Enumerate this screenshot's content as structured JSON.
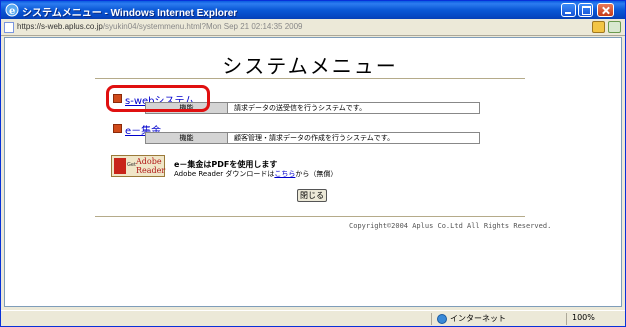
{
  "window": {
    "title": "システムメニュー - Windows Internet Explorer"
  },
  "address": {
    "url_prefix": "https://",
    "url_host": "s-web.aplus.co.jp",
    "url_path": "/syukin04/systemmenu.html?Mon Sep 21 02:14:35 2009"
  },
  "page": {
    "title": "システムメニュー",
    "systems": [
      {
        "link": "s-webシステム",
        "label": "機能",
        "description": "請求データの送受信を行うシステムです。"
      },
      {
        "link": "e－集金",
        "label": "機能",
        "description": "顧客管理・請求データの作成を行うシステムです。"
      }
    ],
    "adobe": {
      "get": "Get",
      "product_line1": "Adobe",
      "product_line2": "Reader",
      "note": "e－集金はPDFを使用します",
      "download_prefix": "Adobe Reader ダウンロードは",
      "download_link": "こちら",
      "download_suffix": "から（無償）"
    },
    "close_button": "閉じる",
    "copyright": "Copyright©2004 Aplus Co.Ltd All Rights Reserved."
  },
  "statusbar": {
    "zone": "インターネット",
    "zoom": "100%"
  }
}
